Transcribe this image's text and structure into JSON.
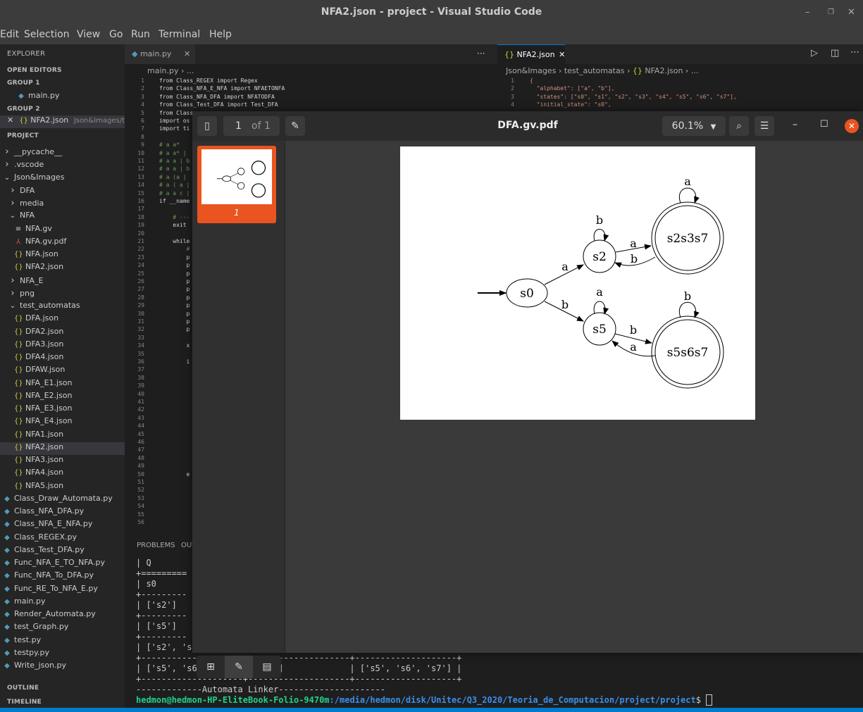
{
  "window": {
    "title": "NFA2.json - project - Visual Studio Code"
  },
  "menu": [
    "Edit",
    "Selection",
    "View",
    "Go",
    "Run",
    "Terminal",
    "Help"
  ],
  "sidebar": {
    "explorer_label": "EXPLORER",
    "open_editors": "OPEN EDITORS",
    "group1": "GROUP 1",
    "group1_file": "main.py",
    "group2": "GROUP 2",
    "group2_file": "NFA2.json",
    "group2_path": "Json&Images/te...",
    "project": "PROJECT",
    "tree": [
      {
        "label": "__pycache__",
        "icon": "chevron-right",
        "indent": 1
      },
      {
        "label": ".vscode",
        "icon": "chevron-right",
        "indent": 1
      },
      {
        "label": "Json&Images",
        "icon": "chevron-down",
        "indent": 1
      },
      {
        "label": "DFA",
        "icon": "chevron-right",
        "indent": 2
      },
      {
        "label": "media",
        "icon": "chevron-right",
        "indent": 2
      },
      {
        "label": "NFA",
        "icon": "chevron-down",
        "indent": 2
      },
      {
        "label": "NFA.gv",
        "icon": "lines",
        "indent": 3
      },
      {
        "label": "NFA.gv.pdf",
        "icon": "pdf",
        "indent": 3
      },
      {
        "label": "NFA.json",
        "icon": "json",
        "indent": 3
      },
      {
        "label": "NFA2.json",
        "icon": "json",
        "indent": 3
      },
      {
        "label": "NFA_E",
        "icon": "chevron-right",
        "indent": 2
      },
      {
        "label": "png",
        "icon": "chevron-right",
        "indent": 2
      },
      {
        "label": "test_automatas",
        "icon": "chevron-down",
        "indent": 2
      },
      {
        "label": "DFA.json",
        "icon": "json",
        "indent": 3
      },
      {
        "label": "DFA2.json",
        "icon": "json",
        "indent": 3
      },
      {
        "label": "DFA3.json",
        "icon": "json",
        "indent": 3
      },
      {
        "label": "DFA4.json",
        "icon": "json",
        "indent": 3
      },
      {
        "label": "DFAW.json",
        "icon": "json",
        "indent": 3
      },
      {
        "label": "NFA_E1.json",
        "icon": "json",
        "indent": 3
      },
      {
        "label": "NFA_E2.json",
        "icon": "json",
        "indent": 3
      },
      {
        "label": "NFA_E3.json",
        "icon": "json",
        "indent": 3
      },
      {
        "label": "NFA_E4.json",
        "icon": "json",
        "indent": 3
      },
      {
        "label": "NFA1.json",
        "icon": "json",
        "indent": 3
      },
      {
        "label": "NFA2.json",
        "icon": "json",
        "indent": 3,
        "selected": true
      },
      {
        "label": "NFA3.json",
        "icon": "json",
        "indent": 3
      },
      {
        "label": "NFA4.json",
        "icon": "json",
        "indent": 3
      },
      {
        "label": "NFA5.json",
        "icon": "json",
        "indent": 3
      },
      {
        "label": "Class_Draw_Automata.py",
        "icon": "py",
        "indent": 1
      },
      {
        "label": "Class_NFA_DFA.py",
        "icon": "py",
        "indent": 1
      },
      {
        "label": "Class_NFA_E_NFA.py",
        "icon": "py",
        "indent": 1
      },
      {
        "label": "Class_REGEX.py",
        "icon": "py",
        "indent": 1
      },
      {
        "label": "Class_Test_DFA.py",
        "icon": "py",
        "indent": 1
      },
      {
        "label": "Func_NFA_E_TO_NFA.py",
        "icon": "py",
        "indent": 1
      },
      {
        "label": "Func_NFA_To_DFA.py",
        "icon": "py",
        "indent": 1
      },
      {
        "label": "Func_RE_To_NFA_E.py",
        "icon": "py",
        "indent": 1
      },
      {
        "label": "main.py",
        "icon": "py",
        "indent": 1
      },
      {
        "label": "Render_Automata.py",
        "icon": "py",
        "indent": 1
      },
      {
        "label": "test_Graph.py",
        "icon": "py",
        "indent": 1
      },
      {
        "label": "test.py",
        "icon": "py",
        "indent": 1
      },
      {
        "label": "testpy.py",
        "icon": "py",
        "indent": 1
      },
      {
        "label": "Write_json.py",
        "icon": "py",
        "indent": 1
      }
    ],
    "outline": "OUTLINE",
    "timeline": "TIMELINE"
  },
  "tabs": {
    "left": "main.py",
    "right": "NFA2.json",
    "more": "···"
  },
  "breadcrumbs": {
    "left": [
      "main.py",
      "..."
    ],
    "right": [
      "Json&Images",
      "test_automatas",
      "NFA2.json",
      "..."
    ]
  },
  "code_lines": [
    "from Class_REGEX import Regex",
    "from Class_NFA_E_NFA import NFAETONFA",
    "from Class_NFA_DFA import NFATODFA",
    "from Class_Test_DFA import Test_DFA",
    "from Class_",
    "import os",
    "import ti",
    "",
    "# a a*",
    "# a a* | ",
    "# a a | b",
    "# a a | b",
    "# a (a | ",
    "# a ( a |",
    "# a a c |",
    "if __name",
    "",
    "    # ---",
    "    exit ",
    "",
    "    while",
    "        #",
    "        p",
    "        p",
    "        p",
    "        p",
    "        p",
    "        p",
    "        p",
    "        p",
    "        p",
    "        p",
    "",
    "        x",
    "",
    "        i",
    "",
    "",
    "",
    "",
    "",
    "",
    "",
    "",
    "",
    "",
    "",
    "",
    "",
    "        e",
    "",
    "",
    "",
    "",
    "",
    ""
  ],
  "json_lines": [
    "{",
    "  \"alphabet\": [\"a\", \"b\"],",
    "  \"states\": [\"s0\", \"s1\", \"s2\", \"s3\", \"s4\", \"s5\", \"s6\", \"s7\"],",
    "  \"initial_state\": \"s0\","
  ],
  "panel": {
    "tab1": "PROBLEMS",
    "tab2": "OUT"
  },
  "terminal_lines": [
    "| Q",
    "+=========",
    "| s0",
    "+---------",
    "| ['s2']",
    "+---------",
    "| ['s5']",
    "+---------",
    "| ['s2', 's",
    "+--------------------+--------------------+--------------------+",
    "| ['s5', 's6', 's7'] | ['s5']             | ['s5', 's6', 's7'] |",
    "+--------------------+--------------------+--------------------+",
    "-------------Automata Linker---------------------"
  ],
  "prompt": {
    "user": "hedmon@hedmon-HP-EliteBook-Folio-9470m",
    "path": ":/media/hedmon/disk/Unitec/Q3_2020/Teoria_de_Computacion/project/project",
    "symbol": "$ "
  },
  "pdf": {
    "title": "DFA.gv.pdf",
    "page": "1",
    "of": "of 1",
    "zoom": "60.1%",
    "thumb_label": "1"
  },
  "graph": {
    "nodes": [
      {
        "id": "s0",
        "accepting": false
      },
      {
        "id": "s2",
        "accepting": false
      },
      {
        "id": "s5",
        "accepting": false
      },
      {
        "id": "s2s3s7",
        "accepting": true
      },
      {
        "id": "s5s6s7",
        "accepting": true
      }
    ],
    "edges": [
      {
        "from": "s0",
        "to": "s2",
        "label": "a"
      },
      {
        "from": "s0",
        "to": "s5",
        "label": "b"
      },
      {
        "from": "s2",
        "to": "s2",
        "label": "b"
      },
      {
        "from": "s2",
        "to": "s2s3s7",
        "label": "a"
      },
      {
        "from": "s2s3s7",
        "to": "s2",
        "label": "b"
      },
      {
        "from": "s2s3s7",
        "to": "s2s3s7",
        "label": "a"
      },
      {
        "from": "s5",
        "to": "s5",
        "label": "a"
      },
      {
        "from": "s5",
        "to": "s5s6s7",
        "label": "b"
      },
      {
        "from": "s5s6s7",
        "to": "s5",
        "label": "a"
      },
      {
        "from": "s5s6s7",
        "to": "s5s6s7",
        "label": "b"
      }
    ]
  }
}
